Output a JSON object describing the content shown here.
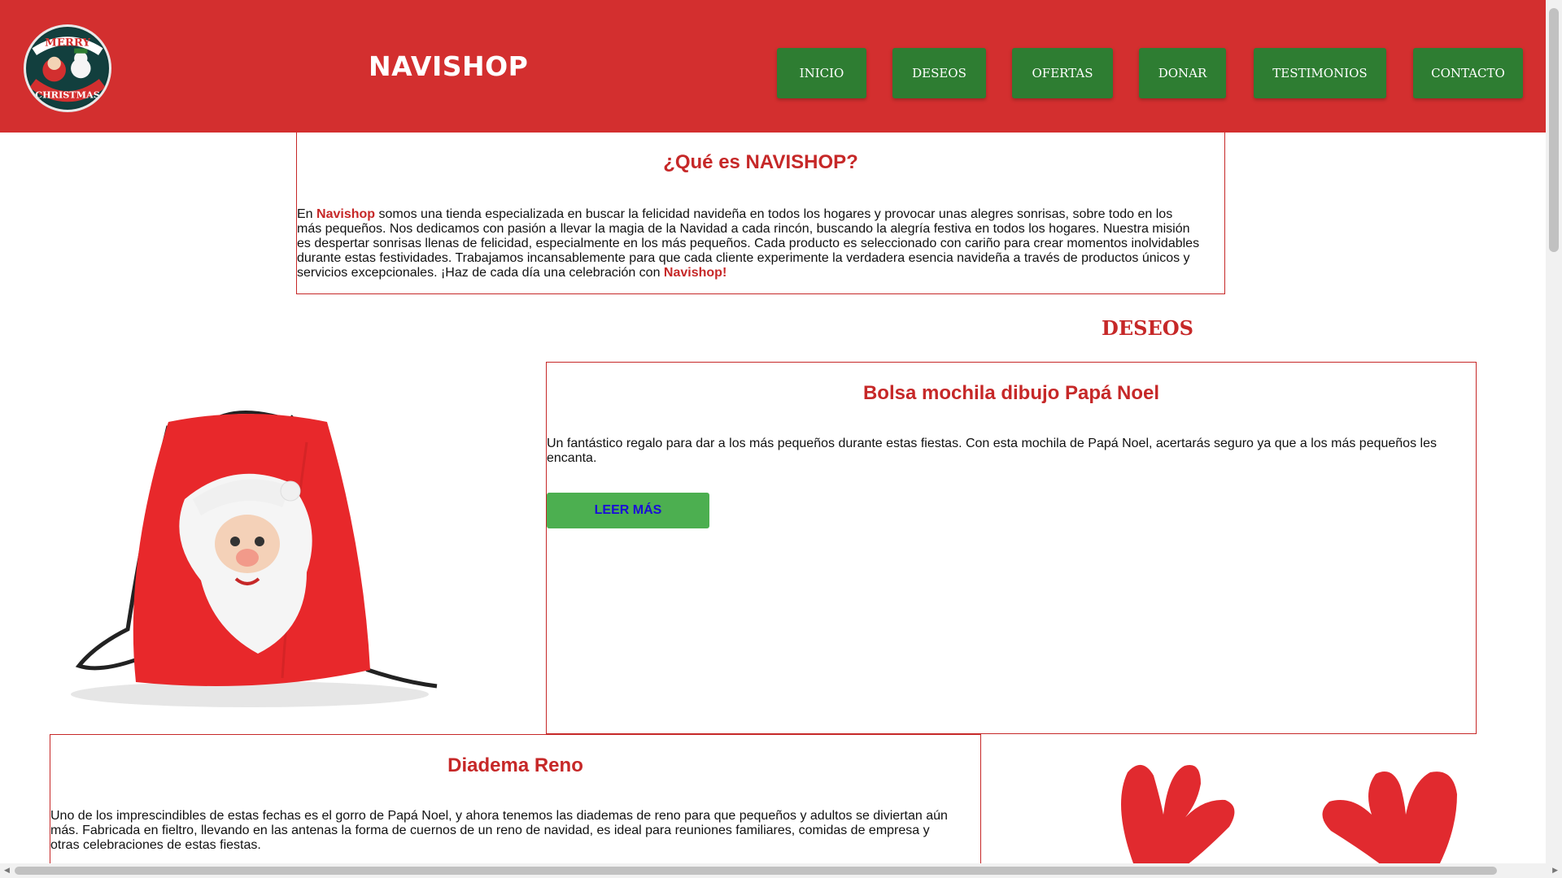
{
  "header": {
    "brand": "NAVISHOP",
    "logo_text_top": "MERRY",
    "logo_text_bottom": "CHRISTMAS",
    "nav": [
      "INICIO",
      "DESEOS",
      "OFERTAS",
      "DONAR",
      "TESTIMONIOS",
      "CONTACTO"
    ]
  },
  "about": {
    "title": "¿Qué es NAVISHOP?",
    "text_part1": "En ",
    "brand": "Navishop",
    "text_part2": " somos una tienda especializada en buscar la felicidad navideña en todos los hogares y provocar unas alegres sonrisas, sobre todo en los más pequeños. Nos dedicamos con pasión a llevar la magia de la Navidad a cada rincón, buscando la alegría festiva en todos los hogares. Nuestra misión es despertar sonrisas llenas de felicidad, especialmente en los más pequeños. Cada producto es seleccionado con cariño para crear momentos inolvidables durante estas festividades. Trabajamos incansablemente para que cada cliente experimente la verdadera esencia navideña a través de productos únicos y servicios excepcionales. ¡Haz de cada día una celebración con ",
    "brand2": "Navishop",
    "text_part3": "!"
  },
  "wishes": {
    "section_title": "DESEOS",
    "products": [
      {
        "title": "Bolsa mochila dibujo Papá Noel",
        "description": "Un fantástico regalo para dar a los más pequeños durante estas fiestas. Con esta mochila de Papá Noel, acertarás seguro ya que a los más pequeños les encanta.",
        "button": "LEER MÁS"
      },
      {
        "title": "Diadema Reno",
        "description": "Uno de los imprescindibles de estas fechas es el gorro de Papá Noel, y ahora tenemos las diademas de reno para que pequeños y adultos se diviertan aún más. Fabricada en fieltro, llevando en las antenas la forma de cuernos de un reno de navidad, es ideal para reuniones familiares, comidas de empresa y otras celebraciones de estas fiestas."
      }
    ]
  },
  "colors": {
    "header_red": "#d32f2f",
    "nav_green": "#2e7d32",
    "accent_red": "#c62828",
    "button_green": "#4caf50",
    "button_text": "#1a0dd8"
  }
}
